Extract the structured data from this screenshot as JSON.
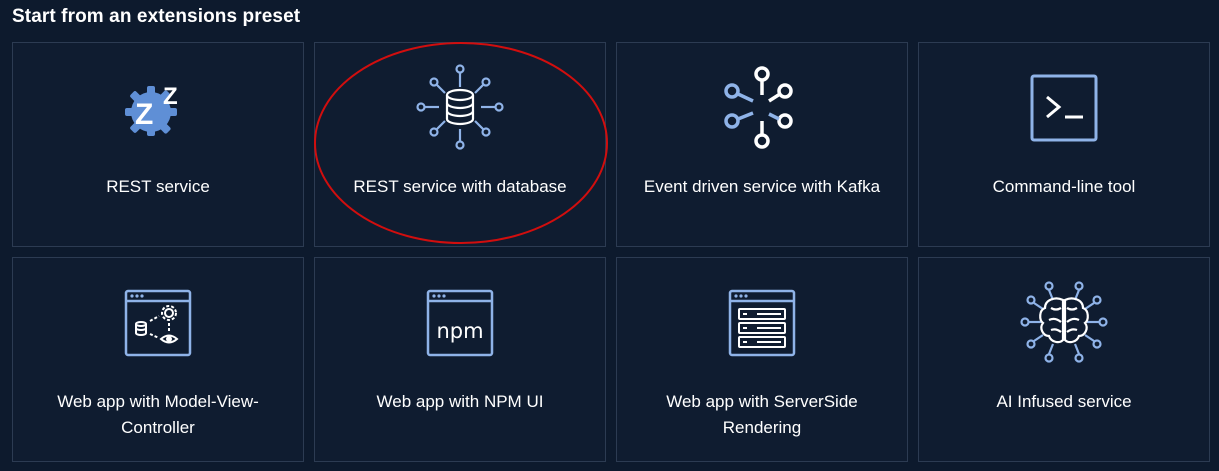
{
  "section": {
    "title": "Start from an extensions preset"
  },
  "presets": [
    {
      "label": "REST service",
      "icon": "rest-gear-icon"
    },
    {
      "label": "REST service with database",
      "icon": "database-icon"
    },
    {
      "label": "Event driven service with Kafka",
      "icon": "kafka-icon"
    },
    {
      "label": "Command-line tool",
      "icon": "terminal-icon"
    },
    {
      "label": "Web app with Model-View-Controller",
      "icon": "mvc-window-icon"
    },
    {
      "label": "Web app with NPM UI",
      "icon": "npm-window-icon"
    },
    {
      "label": "Web app with ServerSide Rendering",
      "icon": "ssr-window-icon"
    },
    {
      "label": "AI Infused service",
      "icon": "ai-brain-icon"
    }
  ],
  "colors": {
    "background": "#0d1a2d",
    "card_border": "#2c3b52",
    "icon_blue": "#8fb3e8",
    "highlight_red": "#d10e0e"
  }
}
